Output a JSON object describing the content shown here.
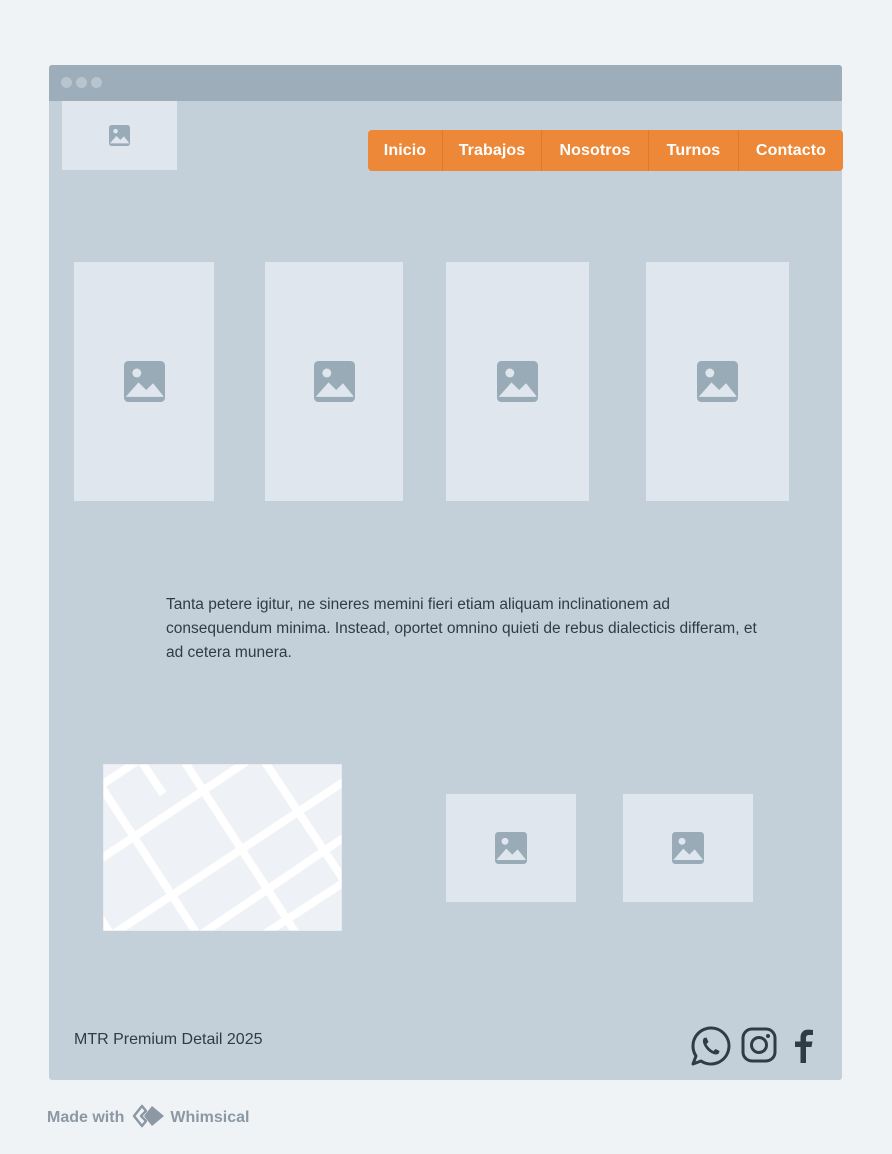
{
  "colors": {
    "frame": "#c3d0d9",
    "titlebar": "#9dadb9",
    "placeholder": "#e0e6ee",
    "icon": "#9aabb8",
    "nav": "#ec8838",
    "text": "#2f3b47"
  },
  "nav": {
    "items": [
      {
        "label": "Inicio"
      },
      {
        "label": "Trabajos"
      },
      {
        "label": "Nosotros"
      },
      {
        "label": "Turnos"
      },
      {
        "label": "Contacto"
      }
    ]
  },
  "gallery": {
    "images": [
      {
        "icon": "image-icon"
      },
      {
        "icon": "image-icon"
      },
      {
        "icon": "image-icon"
      },
      {
        "icon": "image-icon"
      }
    ]
  },
  "content": {
    "paragraph": "Tanta petere igitur, ne sineres memini fieri etiam aliquam inclinationem ad consequendum minima. Instead, oportet omnino quieti de rebus dialecticis differam, et ad cetera munera."
  },
  "footer": {
    "copyright": "MTR Premium Detail 2025",
    "social": [
      "whatsapp-icon",
      "instagram-icon",
      "facebook-icon"
    ]
  },
  "watermark": {
    "made_with": "Made with",
    "brand": "Whimsical"
  }
}
